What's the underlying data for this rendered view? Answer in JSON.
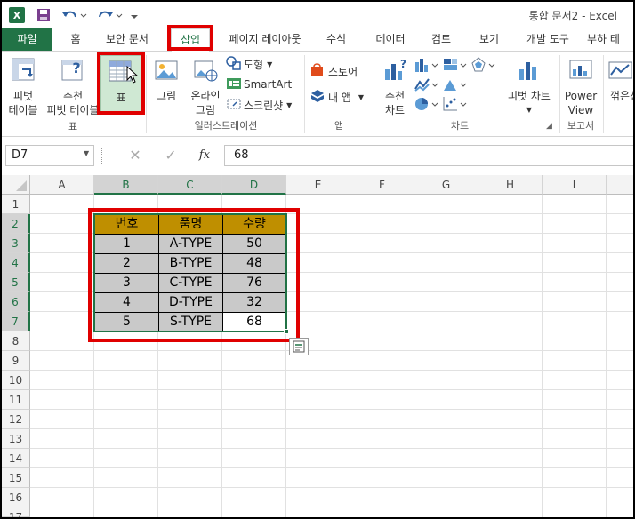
{
  "window": {
    "title": "통합 문서2 - Excel"
  },
  "qat": {
    "excel_icon": "excel-logo-icon",
    "save_icon": "save-icon",
    "undo_icon": "undo-icon",
    "redo_icon": "redo-icon"
  },
  "tabs": [
    {
      "label": "파일"
    },
    {
      "label": "홈"
    },
    {
      "label": "보안 문서"
    },
    {
      "label": "삽입"
    },
    {
      "label": "페이지 레이아웃"
    },
    {
      "label": "수식"
    },
    {
      "label": "데이터"
    },
    {
      "label": "검토"
    },
    {
      "label": "보기"
    },
    {
      "label": "개발 도구"
    },
    {
      "label": "부하 테"
    }
  ],
  "ribbon": {
    "pivot_table": {
      "line1": "피벗",
      "line2": "테이블"
    },
    "recommended_pivot": {
      "line1": "추천",
      "line2": "피벗 테이블"
    },
    "table": {
      "label": "표"
    },
    "picture": {
      "label": "그림"
    },
    "online_picture": {
      "line1": "온라인",
      "line2": "그림"
    },
    "shapes": {
      "label": "도형"
    },
    "smartart": {
      "label": "SmartArt"
    },
    "screenshot": {
      "label": "스크린샷"
    },
    "store": {
      "label": "스토어"
    },
    "my_apps": {
      "label": "내 앱"
    },
    "recommended_charts": {
      "line1": "추천",
      "line2": "차트"
    },
    "pivot_chart": {
      "label": "피벗 차트"
    },
    "power_view": {
      "line1": "Power",
      "line2": "View"
    },
    "line_sparkline": {
      "label": "꺾은선"
    },
    "groups": {
      "tables": "표",
      "illustrations": "일러스트레이션",
      "apps": "앱",
      "charts": "차트",
      "reports": "보고서"
    }
  },
  "formula_bar": {
    "name_box": "D7",
    "fx": "fx",
    "value": "68"
  },
  "columns": [
    "A",
    "B",
    "C",
    "D",
    "E",
    "F",
    "G",
    "H",
    "I"
  ],
  "rows": [
    "1",
    "2",
    "3",
    "4",
    "5",
    "6",
    "7",
    "8",
    "9",
    "10",
    "11",
    "12",
    "13",
    "14",
    "15",
    "16",
    "17"
  ],
  "table": {
    "headers": [
      "번호",
      "품명",
      "수량"
    ],
    "rows": [
      [
        "1",
        "A-TYPE",
        "50"
      ],
      [
        "2",
        "B-TYPE",
        "48"
      ],
      [
        "3",
        "C-TYPE",
        "76"
      ],
      [
        "4",
        "D-TYPE",
        "32"
      ],
      [
        "5",
        "S-TYPE",
        "68"
      ]
    ]
  },
  "colors": {
    "excel_green": "#217346",
    "header_fill": "#bf8f00",
    "body_fill": "#c9c9c9",
    "highlight": "#e00000"
  }
}
